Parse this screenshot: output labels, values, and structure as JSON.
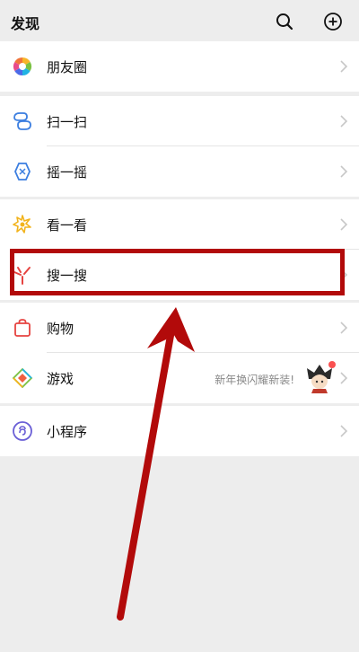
{
  "header": {
    "title": "发现",
    "search_icon": "search-icon",
    "add_icon": "plus-circle-icon"
  },
  "items": {
    "moments": {
      "label": "朋友圈",
      "icon": "moments-aperture-icon"
    },
    "scan": {
      "label": "扫一扫",
      "icon": "scan-icon"
    },
    "shake": {
      "label": "摇一摇",
      "icon": "shake-icon"
    },
    "look": {
      "label": "看一看",
      "icon": "look-sparkle-icon"
    },
    "search": {
      "label": "搜一搜",
      "icon": "search-sparkle-icon"
    },
    "shopping": {
      "label": "购物",
      "icon": "shopping-bag-icon"
    },
    "games": {
      "label": "游戏",
      "icon": "games-diamond-icon",
      "promo": "新年换闪耀新装!"
    },
    "miniprogram": {
      "label": "小程序",
      "icon": "mini-program-icon"
    }
  },
  "colors": {
    "background": "#ededed",
    "cell": "#ffffff",
    "highlight": "#b20a0a",
    "badge": "#fa5151"
  }
}
